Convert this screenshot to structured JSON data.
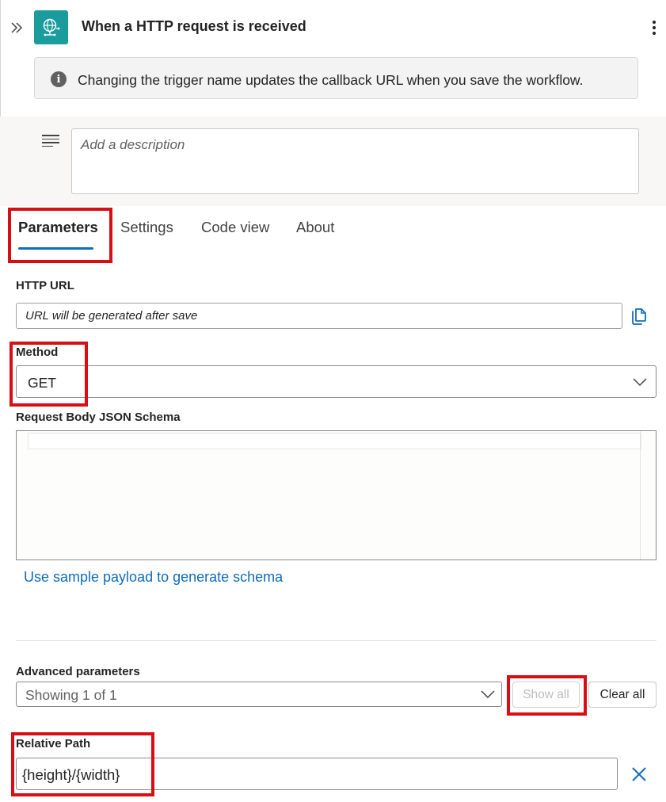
{
  "header": {
    "title": "When a HTTP request is received",
    "trigger_icon": "globe-network-icon",
    "collapse_icon": "double-chevron-right-icon",
    "more_icon": "more-vertical-icon"
  },
  "info_banner": {
    "icon": "info-icon",
    "glyph": "i",
    "text": "Changing the trigger name updates the callback URL when you save the workflow."
  },
  "description": {
    "icon": "description-lines-icon",
    "placeholder": "Add a description"
  },
  "tabs": [
    {
      "label": "Parameters",
      "active": true
    },
    {
      "label": "Settings",
      "active": false
    },
    {
      "label": "Code view",
      "active": false
    },
    {
      "label": "About",
      "active": false
    }
  ],
  "parameters": {
    "http_url": {
      "label": "HTTP URL",
      "value": "URL will be generated after save",
      "copy_icon": "copy-icon"
    },
    "method": {
      "label": "Method",
      "value": "GET"
    },
    "schema": {
      "label": "Request Body JSON Schema",
      "value": ""
    },
    "sample_link": "Use sample payload to generate schema",
    "advanced": {
      "label": "Advanced parameters",
      "value": "Showing 1 of 1",
      "show_all": "Show all",
      "clear_all": "Clear all"
    },
    "relative_path": {
      "label": "Relative Path",
      "value": "{height}/{width}",
      "remove_icon": "close-icon"
    }
  },
  "colors": {
    "accent": "#0f6cbd",
    "highlight": "#d80e15",
    "trigger_icon_bg": "#1b9c9c"
  }
}
